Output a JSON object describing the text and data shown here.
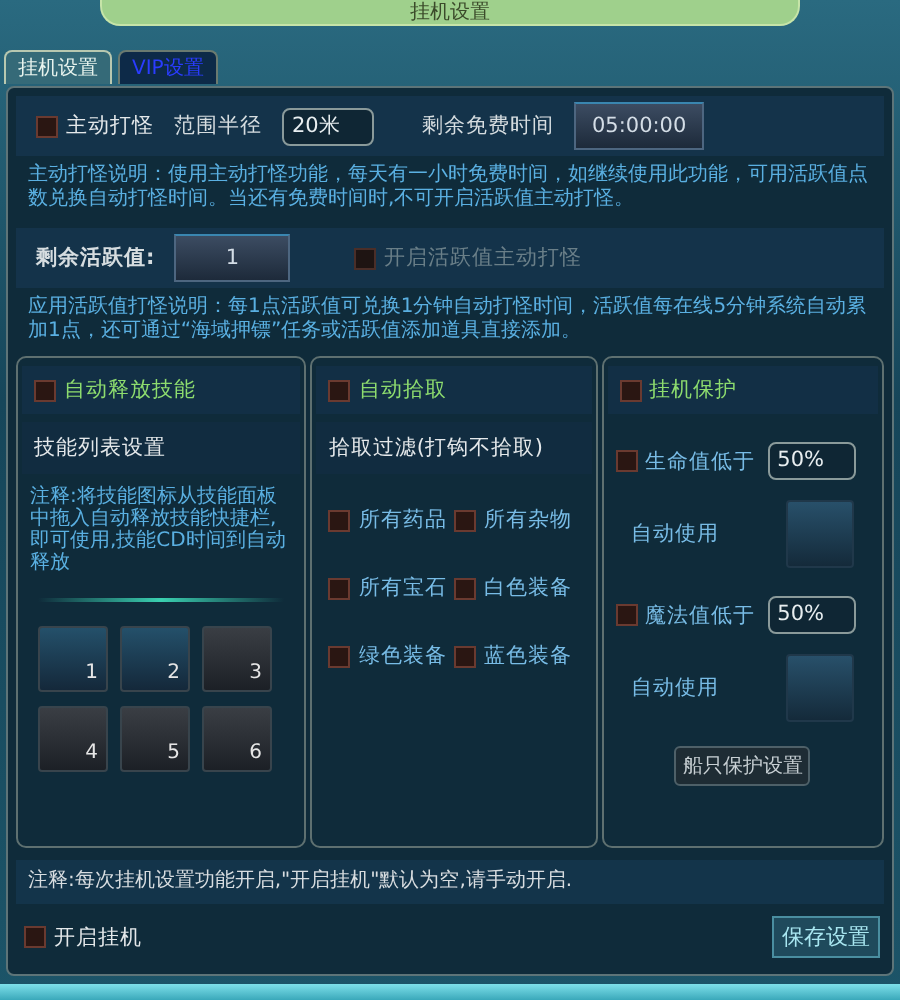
{
  "window": {
    "title": "挂机设置"
  },
  "tabs": [
    {
      "label": "挂机设置",
      "selected": true
    },
    {
      "label": "VIP设置",
      "selected": false
    }
  ],
  "auto_attack": {
    "toggle": {
      "label": "主动打怪",
      "checked": false
    },
    "range_label": "范围半径",
    "range_value": "20米",
    "free_time_label": "剩余免费时间",
    "free_time": "05:00:00",
    "description": "主动打怪说明：使用主动打怪功能，每天有一小时免费时间，如继续使用此功能，可用活跃值点数兑换自动打怪时间。当还有免费时间时,不可开启活跃值主动打怪。"
  },
  "activity": {
    "label": "剩余活跃值:",
    "value": "1",
    "toggle": {
      "label": "开启活跃值主动打怪",
      "checked": false,
      "disabled": true
    },
    "description": "应用活跃值打怪说明：每1点活跃值可兑换1分钟自动打怪时间，活跃值每在线5分钟系统自动累加1点，还可通过“海域押镖”任务或活跃值添加道具直接添加。"
  },
  "skills_panel": {
    "toggle": {
      "label": "自动释放技能",
      "checked": false
    },
    "subtitle": "技能列表设置",
    "note": "注释:将技能图标从技能面板中拖入自动释放技能快捷栏,即可使用,技能CD时间到自动释放",
    "slots": [
      {
        "label": "1",
        "filled": true
      },
      {
        "label": "2",
        "filled": true
      },
      {
        "label": "3",
        "filled": false
      },
      {
        "label": "4",
        "filled": false
      },
      {
        "label": "5",
        "filled": false
      },
      {
        "label": "6",
        "filled": false
      }
    ]
  },
  "pickup_panel": {
    "toggle": {
      "label": "自动拾取",
      "checked": false
    },
    "subtitle": "拾取过滤(打钩不拾取)",
    "items": [
      {
        "label": "所有药品",
        "checked": false
      },
      {
        "label": "所有杂物",
        "checked": false
      },
      {
        "label": "所有宝石",
        "checked": false
      },
      {
        "label": "白色装备",
        "checked": false
      },
      {
        "label": "绿色装备",
        "checked": false
      },
      {
        "label": "蓝色装备",
        "checked": false
      }
    ]
  },
  "protection_panel": {
    "toggle": {
      "label": "挂机保护",
      "checked": false
    },
    "thresholds": [
      {
        "label": "生命值低于",
        "checked": false,
        "value": "50%",
        "auto_use_label": "自动使用"
      },
      {
        "label": "魔法值低于",
        "checked": false,
        "value": "50%",
        "auto_use_label": "自动使用"
      }
    ],
    "ship_button": "船只保护设置"
  },
  "note": "注释:每次挂机设置功能开启,\"开启挂机\"默认为空,请手动开启.",
  "footer": {
    "toggle": {
      "label": "开启挂机",
      "checked": false
    },
    "save_button": "保存设置"
  }
}
